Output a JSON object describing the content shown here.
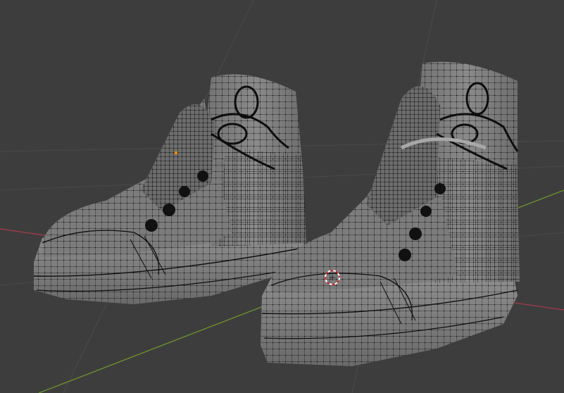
{
  "viewport": {
    "mode": "edit-mode-wireframe",
    "background_color": "#3d3d3d",
    "grid_color": "#4a4a4a",
    "axis_x_color": "#9a3b47",
    "axis_y_color": "#6c8f2d",
    "mesh_fill_color": "#8c8c8c",
    "mesh_shade_color": "#6e6e6e",
    "wire_color": "#0d0d0d",
    "vertex_color": "#000000",
    "selected_vertex_color": "#ff8a00",
    "cursor_colors": [
      "#ffffff",
      "#d9262b"
    ]
  },
  "scene": {
    "objects": [
      {
        "name_icon": "left-sneaker-mesh"
      },
      {
        "name_icon": "right-sneaker-mesh"
      }
    ],
    "overlays": {
      "cursor_icon": "3d-cursor-icon"
    }
  }
}
